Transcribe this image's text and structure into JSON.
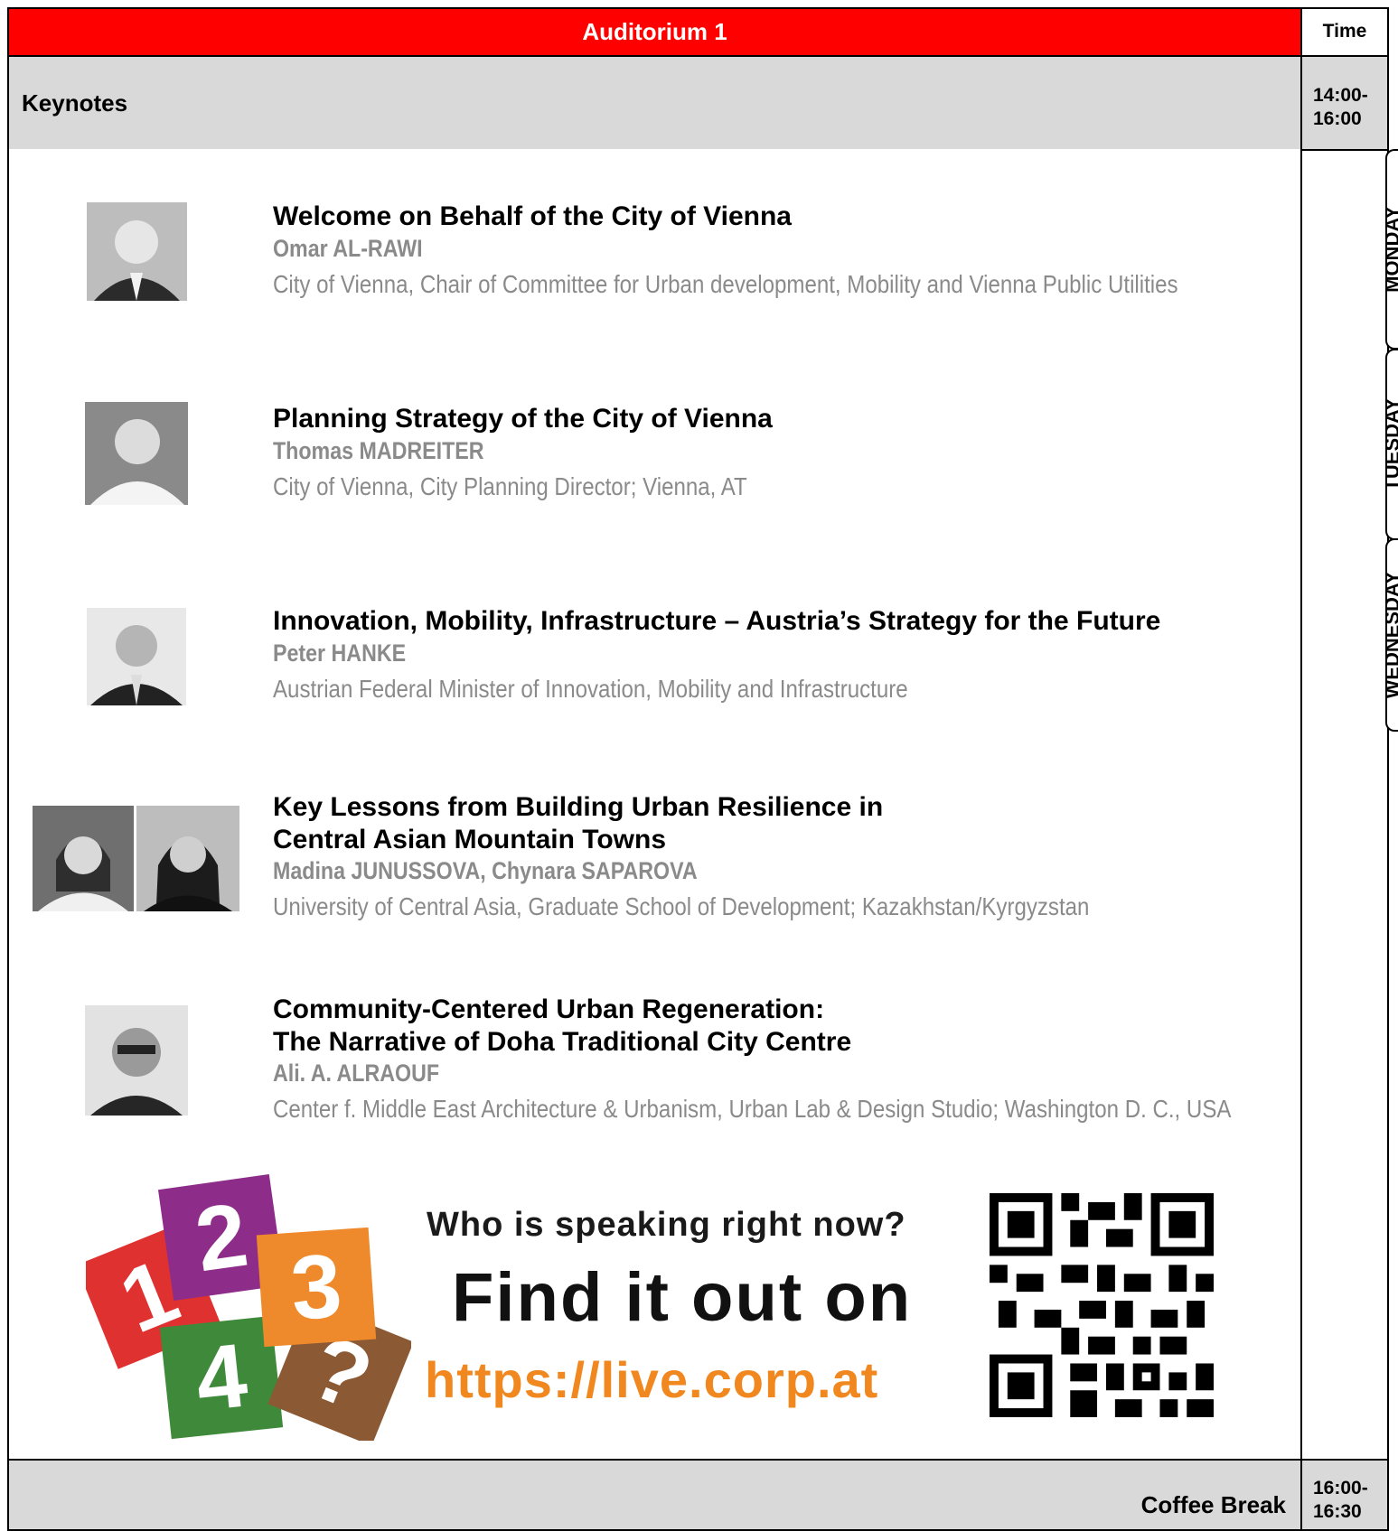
{
  "header": {
    "room": "Auditorium 1",
    "time_label": "Time"
  },
  "session": {
    "name": "Keynotes",
    "time": [
      "14:00-",
      "16:00"
    ]
  },
  "day_tabs": [
    "MONDAY",
    "TUESDAY",
    "WEDNESDAY"
  ],
  "talks": [
    {
      "title": [
        "Welcome on Behalf of the City of Vienna"
      ],
      "speaker": "Omar AL-RAWI",
      "affiliation": "City of Vienna, Chair of Committee for Urban development, Mobility and Vienna Public Utilities"
    },
    {
      "title": [
        "Planning Strategy of the City of Vienna"
      ],
      "speaker": "Thomas MADREITER",
      "affiliation": "City of Vienna, City Planning Director; Vienna, AT"
    },
    {
      "title": [
        "Innovation, Mobility, Infrastructure – Austria’s Strategy for the Future"
      ],
      "speaker": "Peter HANKE",
      "affiliation": "Austrian Federal Minister of Innovation, Mobility and Infrastructure"
    },
    {
      "title": [
        "Key Lessons from Building Urban Resilience in",
        "Central Asian Mountain Towns"
      ],
      "speaker": "Madina JUNUSSOVA, Chynara SAPAROVA",
      "affiliation": "University of Central Asia, Graduate School of Development; Kazakhstan/Kyrgyzstan"
    },
    {
      "title": [
        "Community-Centered Urban Regeneration:",
        "The Narrative of Doha Traditional City Centre"
      ],
      "speaker": "Ali. A. ALRAOUF",
      "affiliation": "Center f. Middle East Architecture & Urbanism, Urban Lab & Design Studio; Washington D. C., USA"
    }
  ],
  "promo": {
    "question": "Who is speaking right now?",
    "headline": "Find it out on",
    "url": "https://live.corp.at",
    "tiles": [
      "1",
      "2",
      "3",
      "4",
      "?"
    ],
    "tile_colors": [
      "#e03131",
      "#8e2c8a",
      "#ef8a2c",
      "#3f8a3a",
      "#8b5a34"
    ]
  },
  "coffee": {
    "label": "Coffee Break",
    "time": [
      "16:00-",
      "16:30"
    ]
  }
}
